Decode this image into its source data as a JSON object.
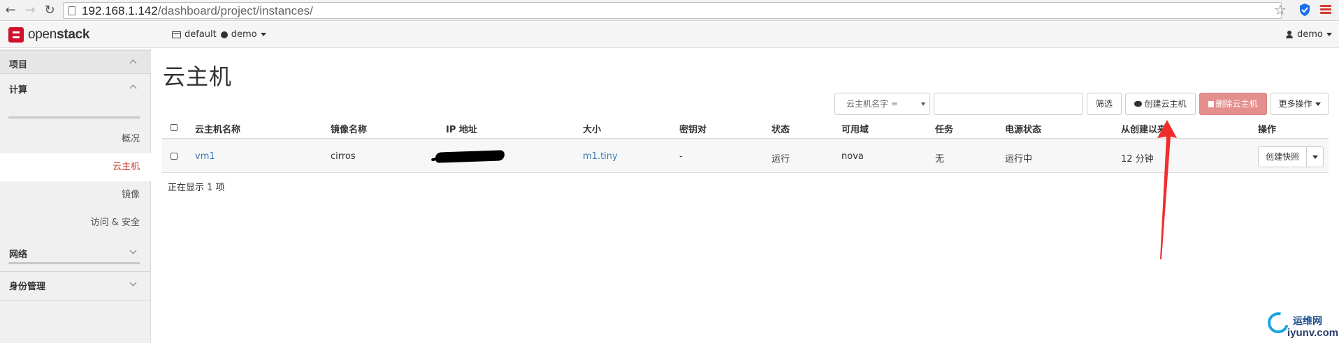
{
  "browser": {
    "url_host": "192.168.1.142",
    "url_path": "/dashboard/project/instances/"
  },
  "header": {
    "logo_left": "open",
    "logo_right": "stack",
    "domain": "default",
    "project": "demo",
    "user": "demo"
  },
  "sidebar": {
    "project": "项目",
    "compute": "计算",
    "items": [
      "概况",
      "云主机",
      "镜像",
      "访问 & 安全"
    ],
    "network": "网络",
    "identity": "身份管理"
  },
  "page": {
    "title": "云主机"
  },
  "toolbar": {
    "filter_field": "云主机名字 =",
    "filter_value": "",
    "filter_btn": "筛选",
    "create_btn": "创建云主机",
    "delete_btn": "删除云主机",
    "more_btn": "更多操作"
  },
  "table": {
    "columns": [
      "云主机名称",
      "镜像名称",
      "IP 地址",
      "大小",
      "密钥对",
      "状态",
      "可用域",
      "任务",
      "电源状态",
      "从创建以来",
      "操作"
    ],
    "rows": [
      {
        "name": "vm1",
        "image": "cirros",
        "ip": "",
        "size": "m1.tiny",
        "keypair": "-",
        "status": "运行",
        "zone": "nova",
        "task": "无",
        "power": "运行中",
        "age": "12 分钟",
        "action": "创建快照"
      }
    ],
    "footer": "正在显示 1 项"
  },
  "annotation": {
    "arrow_color": "#f02d2d"
  },
  "watermark": {
    "cn": "运维网",
    "en": "iyunv.com"
  }
}
